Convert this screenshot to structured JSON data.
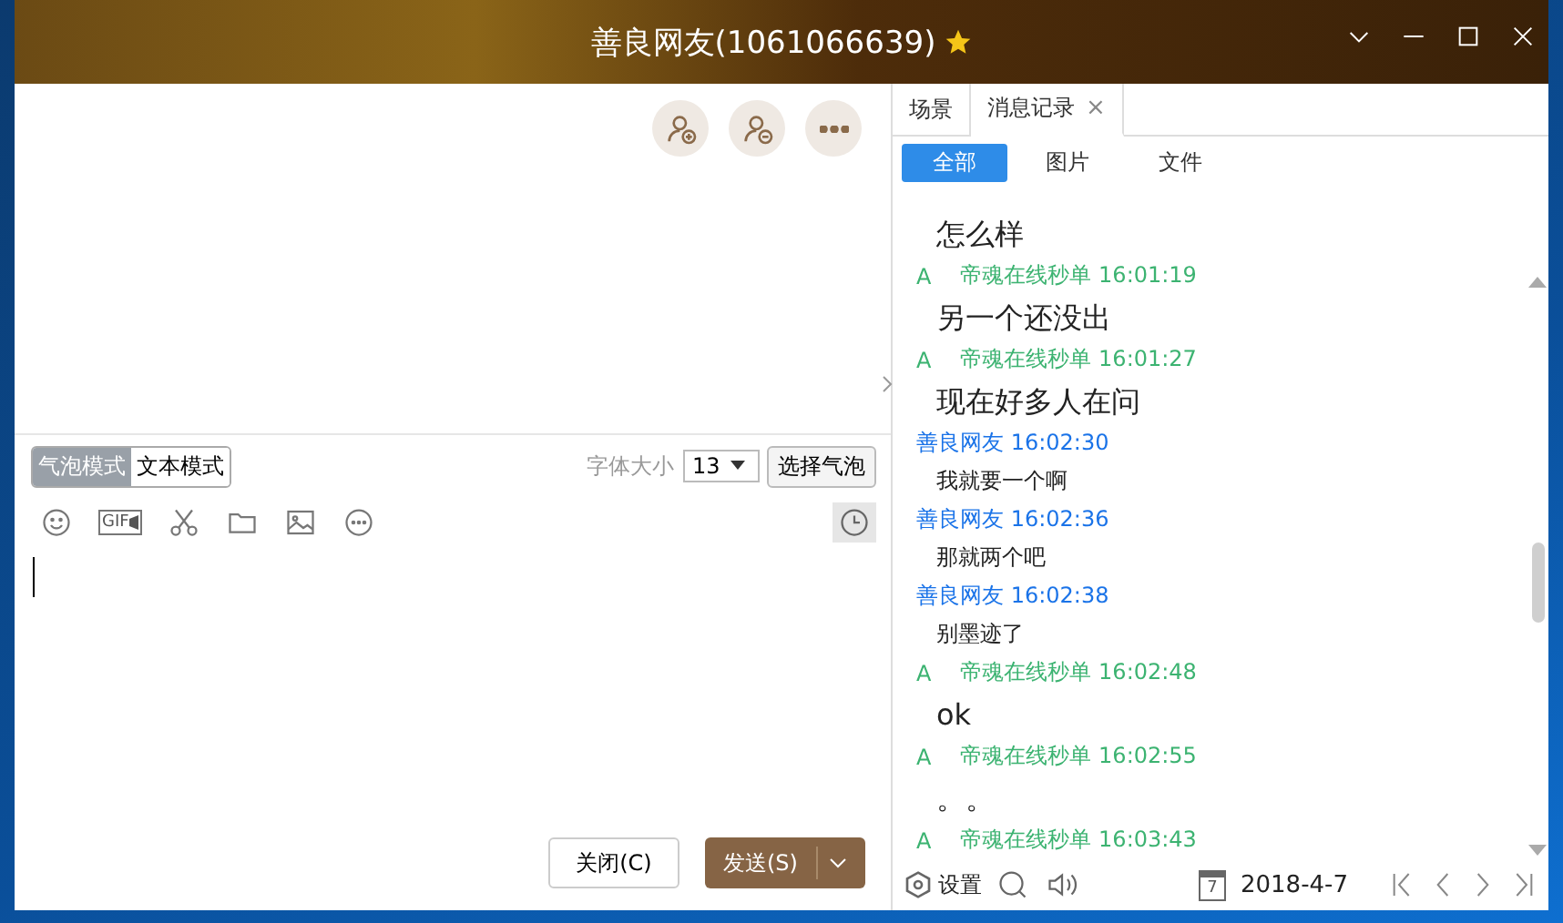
{
  "window": {
    "title": "善良网友(1061066639)"
  },
  "chat_actions": [
    {
      "kind": "add"
    },
    {
      "kind": "remove"
    },
    {
      "kind": "more"
    }
  ],
  "mode_toggle": [
    {
      "label": "气泡模式",
      "selected": true
    },
    {
      "label": "文本模式",
      "selected": false
    }
  ],
  "font_size": {
    "label": "字体大小",
    "value": "13"
  },
  "bubble_button": "选择气泡",
  "toolbar": {
    "gif_label": "GIF"
  },
  "buttons": {
    "close": "关闭(C)",
    "send": "发送(S)"
  },
  "side_tabs": [
    {
      "label": "场景",
      "selected": false,
      "closable": false
    },
    {
      "label": "消息记录",
      "selected": true,
      "closable": true
    }
  ],
  "side_tab_close": "×",
  "filters": [
    {
      "label": "全部",
      "selected": true
    },
    {
      "label": "图片",
      "selected": false
    },
    {
      "label": "文件",
      "selected": false
    }
  ],
  "messages": [
    {
      "kind": "text",
      "text": "怎么样",
      "large": true
    },
    {
      "kind": "header",
      "tag": "A",
      "sender": "帝魂在线秒单",
      "time": "16:01:19",
      "color": "#3cb371"
    },
    {
      "kind": "text",
      "text": "另一个还没出",
      "large": true
    },
    {
      "kind": "header",
      "tag": "A",
      "sender": "帝魂在线秒单",
      "time": "16:01:27",
      "color": "#3cb371"
    },
    {
      "kind": "text",
      "text": "现在好多人在问",
      "large": true
    },
    {
      "kind": "header",
      "sender": "善良网友",
      "time": "16:02:30",
      "color": "#1a73e8"
    },
    {
      "kind": "text",
      "text": "我就要一个啊",
      "large": false
    },
    {
      "kind": "header",
      "sender": "善良网友",
      "time": "16:02:36",
      "color": "#1a73e8"
    },
    {
      "kind": "text",
      "text": "那就两个吧",
      "large": false
    },
    {
      "kind": "header",
      "sender": "善良网友",
      "time": "16:02:38",
      "color": "#1a73e8"
    },
    {
      "kind": "text",
      "text": "别墨迹了",
      "large": false
    },
    {
      "kind": "header",
      "tag": "A",
      "sender": "帝魂在线秒单",
      "time": "16:02:48",
      "color": "#3cb371"
    },
    {
      "kind": "text",
      "text": "ok",
      "large": true
    },
    {
      "kind": "header",
      "tag": "A",
      "sender": "帝魂在线秒单",
      "time": "16:02:55",
      "color": "#3cb371"
    },
    {
      "kind": "text",
      "text": "。。",
      "large": true
    },
    {
      "kind": "header",
      "tag": "A",
      "sender": "帝魂在线秒单",
      "time": "16:03:43",
      "color": "#3cb371"
    }
  ],
  "history_footer": {
    "settings": "设置",
    "date": "2018-4-7",
    "date_day": "7"
  }
}
